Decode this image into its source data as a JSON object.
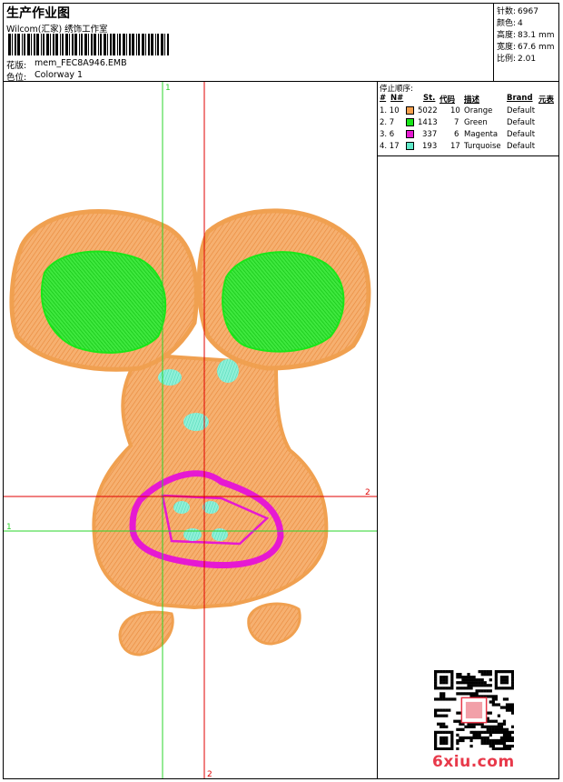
{
  "header": {
    "title": "生产作业图",
    "studio": "Wilcom(汇家) 绣饰工作室",
    "design_label": "花版:",
    "design_value": "mem_FEC8A946.EMB",
    "colorway_label": "色位:",
    "colorway_value": "Colorway 1"
  },
  "stats": [
    {
      "label": "针数:",
      "value": "6967"
    },
    {
      "label": "颜色:",
      "value": "4"
    },
    {
      "label": "高度:",
      "value": "83.1 mm"
    },
    {
      "label": "宽度:",
      "value": "67.6 mm"
    },
    {
      "label": "比例:",
      "value": "2.01"
    }
  ],
  "stops": {
    "title": "停止顺序:",
    "headers": {
      "num": "#",
      "n": "N#",
      "st": "St.",
      "code": "代码",
      "desc": "描述",
      "brand": "Brand",
      "chart": "元表"
    },
    "rows": [
      {
        "num": "1. 10",
        "color": "#f6a04d",
        "st": "5022",
        "code": "10",
        "desc": "Orange",
        "brand": "Default"
      },
      {
        "num": "2. 7",
        "color": "#19e619",
        "st": "1413",
        "code": "7",
        "desc": "Green",
        "brand": "Default"
      },
      {
        "num": "3. 6",
        "color": "#e619d2",
        "st": "337",
        "code": "6",
        "desc": "Magenta",
        "brand": "Default"
      },
      {
        "num": "4. 17",
        "color": "#5fe8c8",
        "st": "193",
        "code": "17",
        "desc": "Turquoise",
        "brand": "Default"
      }
    ]
  },
  "guides": {
    "green_v": "1",
    "green_h": "1",
    "red_h": "2",
    "red_v": "2"
  },
  "colors": {
    "orange": "#f6a04d",
    "green": "#19e619",
    "magenta": "#e619d2",
    "turquoise": "#5fe8c8",
    "guide_green": "#2bd42b",
    "guide_red": "#e00000"
  },
  "watermark": "6xiu.com"
}
